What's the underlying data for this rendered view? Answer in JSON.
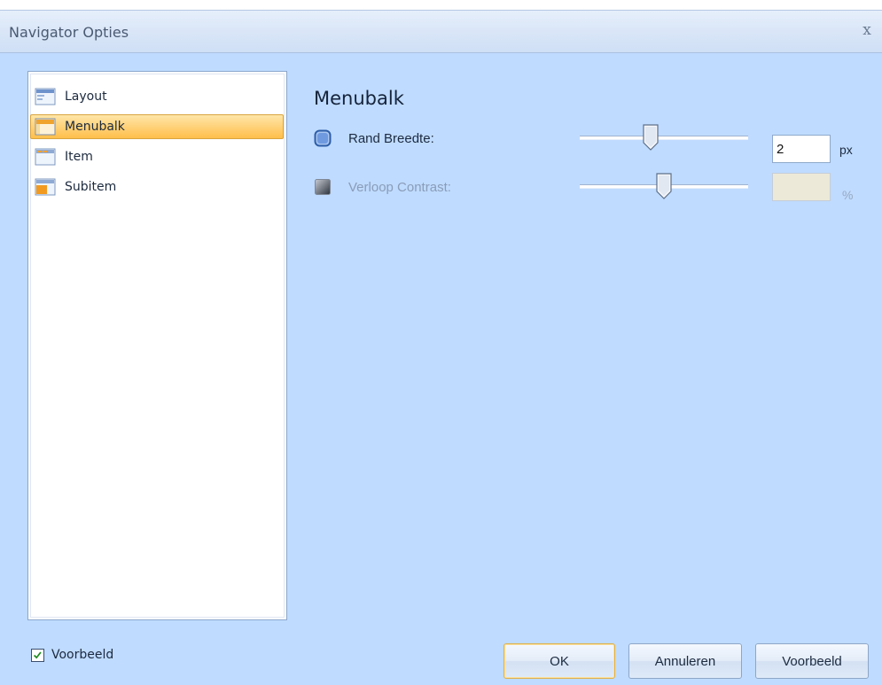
{
  "window": {
    "title": "Navigator Opties",
    "close_glyph": "x"
  },
  "nav": {
    "items": [
      {
        "label": "Layout",
        "icon": "layout-icon",
        "selected": false
      },
      {
        "label": "Menubalk",
        "icon": "menubar-icon",
        "selected": true
      },
      {
        "label": "Item",
        "icon": "item-icon",
        "selected": false
      },
      {
        "label": "Subitem",
        "icon": "subitem-icon",
        "selected": false
      }
    ]
  },
  "panel": {
    "heading": "Menubalk",
    "options": [
      {
        "label": "Rand Breedte:",
        "value": "2",
        "unit": "px",
        "slider_fraction": 0.41,
        "enabled": true
      },
      {
        "label": "Verloop Contrast:",
        "value": "",
        "unit": "%",
        "slider_fraction": 0.5,
        "enabled": false
      }
    ]
  },
  "footer": {
    "preview_checkbox_label": "Voorbeeld",
    "preview_checked": true,
    "ok_label": "OK",
    "cancel_label": "Annuleren",
    "preview_button_label": "Voorbeeld"
  },
  "colors": {
    "window_background": "#bfdbff",
    "selection_orange": "#ffd27a",
    "accent_blue": "#5b8ad6"
  }
}
